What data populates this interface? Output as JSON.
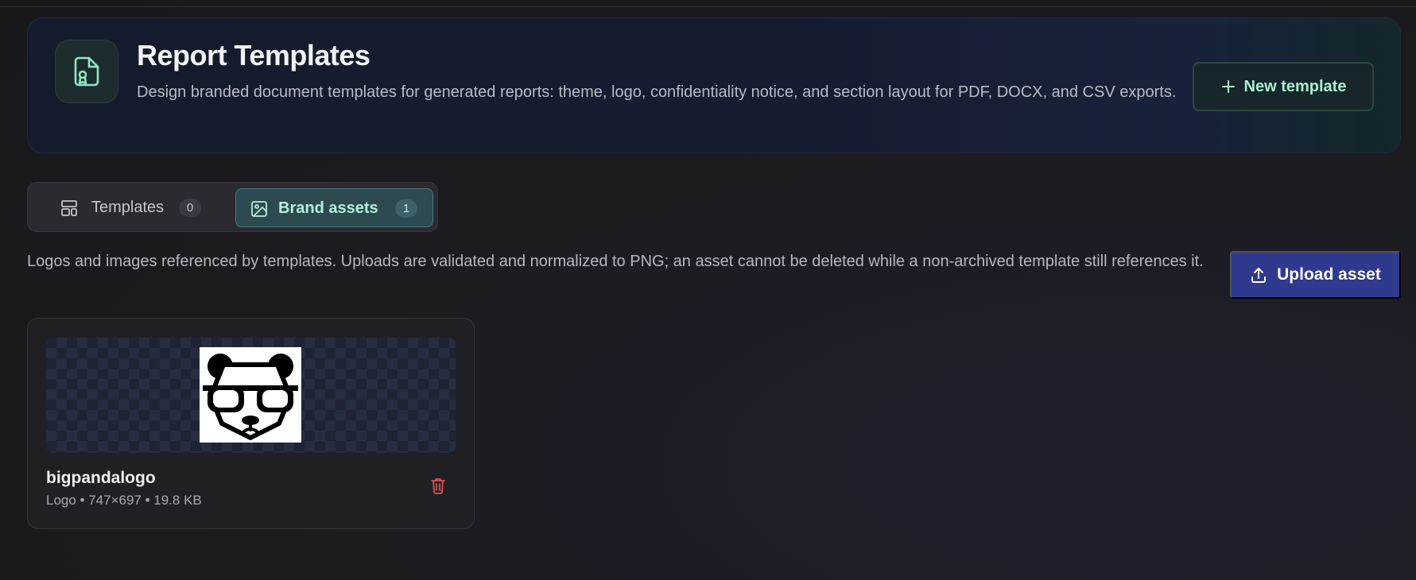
{
  "header": {
    "title": "Report Templates",
    "description": "Design branded document templates for generated reports: theme, logo, confidentiality notice, and section layout for PDF, DOCX, and CSV exports.",
    "icon": "file-badge-icon",
    "new_template_label": "New template"
  },
  "tabs": [
    {
      "label": "Templates",
      "count": "0",
      "icon": "layout-icon",
      "active": false
    },
    {
      "label": "Brand assets",
      "count": "1",
      "icon": "image-icon",
      "active": true
    }
  ],
  "assets_section": {
    "description": "Logos and images referenced by templates. Uploads are validated and normalized to PNG; an asset cannot be deleted while a non-archived template still references it.",
    "upload_label": "Upload asset"
  },
  "assets": [
    {
      "name": "bigpandalogo",
      "meta": "Logo • 747×697 • 19.8 KB",
      "preview_icon": "panda-with-glasses-logo"
    }
  ],
  "colors": {
    "accent_green": "#a9f0cd",
    "primary_button": "#2f3a8f",
    "delete_red": "#d9534f"
  }
}
